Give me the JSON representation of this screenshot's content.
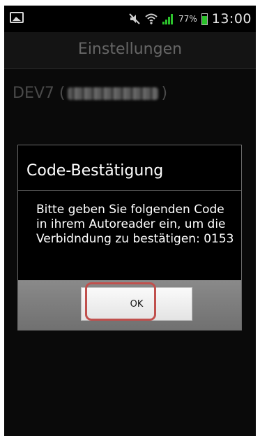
{
  "status_bar": {
    "time": "13:00",
    "battery_percent": "77%",
    "battery_level": 0.77,
    "icons": [
      "gallery-icon",
      "mute-icon",
      "wifi-icon",
      "signal-icon",
      "battery-icon"
    ]
  },
  "header": {
    "title": "Einstellungen"
  },
  "content": {
    "device_label": "DEV7 ("
  },
  "dialog": {
    "title": "Code-Bestätigung",
    "message": "Bitte geben Sie folgenden Code in ihrem Autoreader ein, um die Verbidndung zu bestätigen: 0153",
    "ok_label": "OK"
  },
  "colors": {
    "highlight": "#c0504d",
    "battery_fill": "#2cc22c"
  }
}
